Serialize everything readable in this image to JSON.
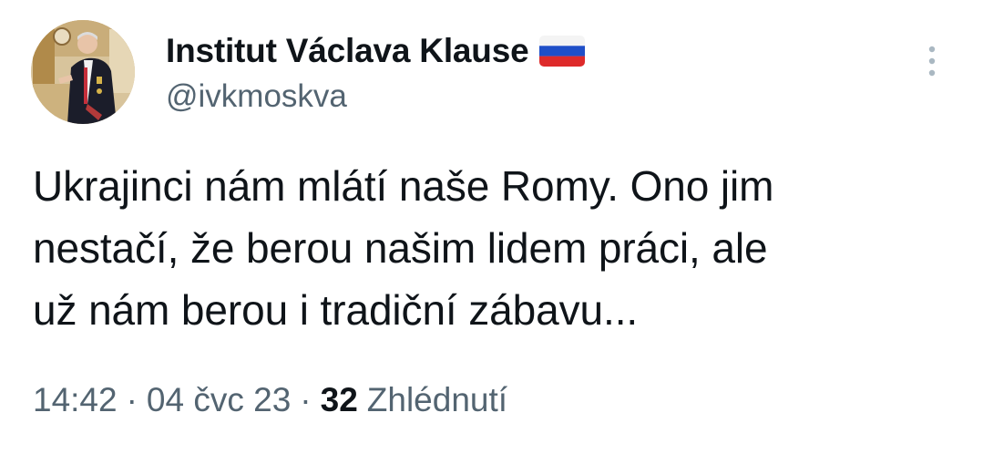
{
  "tweet": {
    "author": {
      "display_name": "Institut Václava Klause",
      "handle": "@ivkmoskva",
      "flag_icon": "russian-flag-icon"
    },
    "text": "Ukrajinci nám mlátí naše Romy. Ono jim\nnestačí, že berou našim lidem práci, ale\nuž nám berou i tradiční zábavu...",
    "time": "14:42",
    "separator": "·",
    "date": "04 čvc 23",
    "views_count": "32",
    "views_label": "Zhlédnutí"
  },
  "colors": {
    "text_primary": "#0f1419",
    "text_secondary": "#536471",
    "more_icon": "#aab8c2",
    "background": "#ffffff"
  },
  "icons": {
    "more": "more-vertical-icon",
    "avatar": "profile-photo"
  }
}
